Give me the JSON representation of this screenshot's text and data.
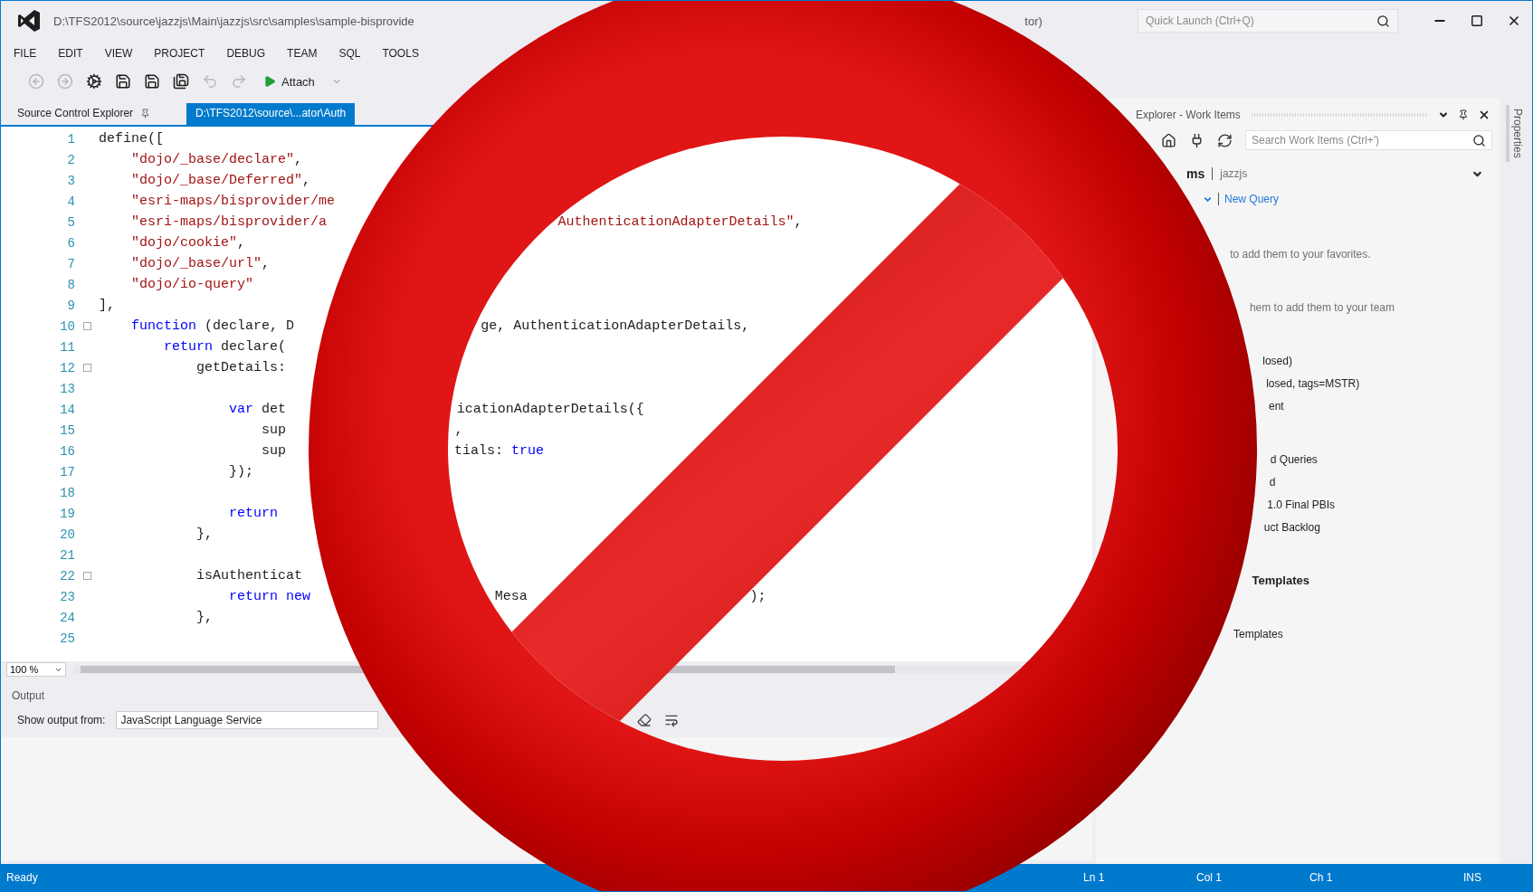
{
  "window": {
    "title": "D:\\TFS2012\\source\\jazzjs\\Main\\jazzjs\\src\\samples\\sample-bisprovide",
    "title_tail": "tor)",
    "quick_launch": {
      "placeholder": "Quick Launch (Ctrl+Q)"
    }
  },
  "menu": [
    "FILE",
    "EDIT",
    "VIEW",
    "PROJECT",
    "DEBUG",
    "TEAM",
    "SQL",
    "TOOLS"
  ],
  "toolbar": {
    "items": [
      {
        "kind": "back",
        "disabled": true
      },
      {
        "kind": "forward",
        "disabled": true
      },
      {
        "kind": "settings",
        "disabled": false
      },
      {
        "kind": "save",
        "disabled": false
      },
      {
        "kind": "save",
        "disabled": false
      },
      {
        "kind": "save_all",
        "disabled": false
      },
      {
        "kind": "undo",
        "disabled": true
      },
      {
        "kind": "redo",
        "disabled": true
      }
    ],
    "run_label": "Attach"
  },
  "document_tabs": [
    {
      "label": "Source Control Explorer",
      "selected": false,
      "pinned": true
    },
    {
      "label": "D:\\TFS2012\\source\\...ator\\Auth",
      "selected": true,
      "pinned": false
    }
  ],
  "editor": {
    "zoom": "100 %",
    "lines": [
      {
        "number": "1",
        "foldable": false,
        "segments": [
          [
            {
              "text": "define([",
              "kind": "plain"
            }
          ]
        ]
      },
      {
        "number": "2",
        "foldable": false,
        "segments": [
          [
            {
              "text": "    \"dojo/_base/declare\"",
              "kind": "string"
            },
            {
              "text": ",",
              "kind": "plain"
            }
          ]
        ]
      },
      {
        "number": "3",
        "foldable": false,
        "segments": [
          [
            {
              "text": "    \"dojo/_base/Deferred\"",
              "kind": "string"
            },
            {
              "text": ",",
              "kind": "plain"
            }
          ]
        ]
      },
      {
        "number": "4",
        "foldable": false,
        "segments": [
          [
            {
              "text": "    \"esri-maps/bisprovider/me",
              "kind": "string"
            }
          ]
        ]
      },
      {
        "number": "5",
        "foldable": false,
        "segments": [
          [
            {
              "text": "    \"esri-maps/bisprovider/a",
              "kind": "string"
            }
          ],
          [
            {
              "text": "AuthenticationAdapterDetails\"",
              "kind": "string"
            },
            {
              "text": ",",
              "kind": "plain"
            }
          ]
        ]
      },
      {
        "number": "6",
        "foldable": false,
        "segments": [
          [
            {
              "text": "    \"dojo/cookie\"",
              "kind": "string"
            },
            {
              "text": ",",
              "kind": "plain"
            }
          ]
        ]
      },
      {
        "number": "7",
        "foldable": false,
        "segments": [
          [
            {
              "text": "    \"dojo/_base/url\"",
              "kind": "string"
            },
            {
              "text": ",",
              "kind": "plain"
            }
          ]
        ]
      },
      {
        "number": "8",
        "foldable": false,
        "segments": [
          [
            {
              "text": "    \"dojo/io-query\"",
              "kind": "string"
            }
          ]
        ]
      },
      {
        "number": "9",
        "foldable": false,
        "segments": [
          [
            {
              "text": "],",
              "kind": "plain"
            }
          ]
        ]
      },
      {
        "number": "10",
        "foldable": true,
        "segments": [
          [
            {
              "text": "    function",
              "kind": "keyword"
            },
            {
              "text": " (declare, D",
              "kind": "plain"
            }
          ],
          [
            {
              "text": "ge, AuthenticationAdapterDetails,",
              "kind": "plain"
            }
          ]
        ]
      },
      {
        "number": "11",
        "foldable": false,
        "segments": [
          [
            {
              "text": "        return",
              "kind": "keyword"
            },
            {
              "text": " declare(",
              "kind": "plain"
            }
          ]
        ]
      },
      {
        "number": "12",
        "foldable": true,
        "segments": [
          [
            {
              "text": "            getDetails:",
              "kind": "plain"
            }
          ]
        ]
      },
      {
        "number": "13",
        "foldable": false
      },
      {
        "number": "14",
        "foldable": false,
        "segments": [
          [
            {
              "text": "                var",
              "kind": "keyword"
            },
            {
              "text": " det",
              "kind": "plain"
            }
          ],
          [
            {
              "text": "icationAdapterDetails({",
              "kind": "plain"
            }
          ]
        ]
      },
      {
        "number": "15",
        "foldable": false,
        "segments": [
          [
            {
              "text": "                    sup",
              "kind": "plain"
            }
          ],
          [
            {
              "text": ",",
              "kind": "plain"
            }
          ]
        ]
      },
      {
        "number": "16",
        "foldable": false,
        "segments": [
          [
            {
              "text": "                    sup",
              "kind": "plain"
            }
          ],
          [
            {
              "text": "tials: ",
              "kind": "plain"
            },
            {
              "text": "true",
              "kind": "keyword"
            }
          ]
        ]
      },
      {
        "number": "17",
        "foldable": false,
        "segments": [
          [
            {
              "text": "                });",
              "kind": "plain"
            }
          ]
        ]
      },
      {
        "number": "18",
        "foldable": false
      },
      {
        "number": "19",
        "foldable": false,
        "segments": [
          [
            {
              "text": "                return",
              "kind": "keyword"
            }
          ]
        ]
      },
      {
        "number": "20",
        "foldable": false,
        "segments": [
          [
            {
              "text": "            },",
              "kind": "plain"
            }
          ]
        ]
      },
      {
        "number": "21",
        "foldable": false
      },
      {
        "number": "22",
        "foldable": true,
        "segments": [
          [
            {
              "text": "            isAuthenticat",
              "kind": "plain"
            }
          ]
        ]
      },
      {
        "number": "23",
        "foldable": false,
        "segments": [
          [
            {
              "text": "                return",
              "kind": "keyword"
            },
            {
              "text": " new",
              "kind": "keyword"
            }
          ],
          [
            {
              "text": "Mesa",
              "kind": "plain"
            }
          ],
          [
            {
              "text": ");",
              "kind": "plain"
            }
          ]
        ]
      },
      {
        "number": "24",
        "foldable": false,
        "segments": [
          [
            {
              "text": "            },",
              "kind": "plain"
            }
          ]
        ]
      },
      {
        "number": "25",
        "foldable": false
      }
    ]
  },
  "output": {
    "title": "Output",
    "source_label": "Show output from:",
    "source": "JavaScript Language Service"
  },
  "team_explorer": {
    "title": "Explorer - Work Items",
    "search": {
      "placeholder": "Search Work Items (Ctrl+')"
    },
    "page": "ms",
    "project": "jazzjs",
    "new_query": "New Query",
    "sections": [
      {
        "items": [
          {
            "kind": "hint",
            "text": "to add them to your favorites."
          }
        ]
      },
      {
        "items": [
          {
            "kind": "hint",
            "text": "hem to add them to your team"
          }
        ]
      },
      {
        "items": [
          {
            "kind": "query",
            "text": "losed)"
          },
          {
            "kind": "query",
            "text": "losed, tags=MSTR)"
          },
          {
            "kind": "query",
            "text": "ent"
          }
        ]
      },
      {
        "items": [
          {
            "kind": "query",
            "text": "d Queries"
          },
          {
            "kind": "query",
            "text": "d"
          },
          {
            "kind": "query",
            "text": "1.0 Final PBIs"
          },
          {
            "kind": "query",
            "text": "uct Backlog"
          }
        ]
      },
      {
        "items": [
          {
            "kind": "heading",
            "text": "Templates"
          }
        ]
      },
      {
        "items": [
          {
            "kind": "query",
            "text": "Templates"
          }
        ]
      }
    ]
  },
  "side_tab": "Properties",
  "status_bar": {
    "message": "Ready",
    "line": "Ln 1",
    "column": "Col 1",
    "char": "Ch 1",
    "mode": "INS"
  }
}
